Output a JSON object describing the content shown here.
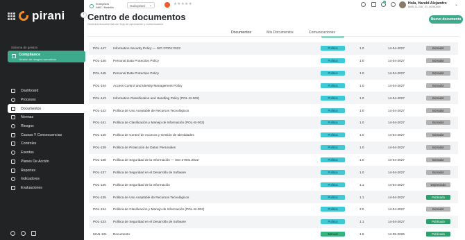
{
  "brand": {
    "logo_text": "pirani",
    "accent": "#3eaa8d",
    "logo_color": "#f28c28"
  },
  "sidebar": {
    "system_label": "Sistema de gestión",
    "system_title": "Compliance",
    "system_subtitle": "Gestión de riesgos normativos",
    "items": [
      {
        "label": "Dashboard",
        "icon": "monitor-icon"
      },
      {
        "label": "Procesos",
        "icon": "process-icon"
      },
      {
        "label": "Documentos",
        "icon": "document-icon",
        "active": true
      },
      {
        "label": "Normas",
        "icon": "list-icon"
      },
      {
        "label": "Riesgos",
        "icon": "risk-icon"
      },
      {
        "label": "Causas Y Consecuencias",
        "icon": "cause-icon"
      },
      {
        "label": "Controles",
        "icon": "controls-icon"
      },
      {
        "label": "Eventos",
        "icon": "event-icon"
      },
      {
        "label": "Planes De Acción",
        "icon": "flag-icon"
      },
      {
        "label": "Reportes",
        "icon": "chart-icon"
      },
      {
        "label": "Indicadores",
        "icon": "gauge-icon"
      },
      {
        "label": "Evaluaciones",
        "icon": "checklist-icon"
      }
    ],
    "footer_icons": [
      "help-icon",
      "users-icon",
      "card-icon"
    ]
  },
  "topbar": {
    "entity_line1": "Enterprises",
    "entity_line2": "NMC / Medellín",
    "guide_label": "Guía pirani",
    "rating": "★★★★★",
    "notification_count": "1",
    "user_name": "Hola, Harold Alejandro",
    "user_sub": "MAN 11.238 · ID: 00000000"
  },
  "header": {
    "title": "Centro de documentos",
    "subtitle": "Gestiona documental con flujo de aprobación y comunicación",
    "new_button": "Nuevo documento"
  },
  "tabs": [
    "Documentos",
    "Mis Documentos",
    "Comunicaciones"
  ],
  "table": {
    "rows": [
      {
        "code": "POL-147",
        "title": "Information Security Policy — ISO 27001:2022",
        "type": "Política",
        "version": "1.0",
        "date": "14-04-2027",
        "status": "Borrador"
      },
      {
        "code": "POL-146",
        "title": "Personal Data Protection Policy",
        "type": "Política",
        "version": "1.0",
        "date": "14-04-2027",
        "status": "Borrador"
      },
      {
        "code": "POL-145",
        "title": "Personal Data Protection Policy",
        "type": "Política",
        "version": "1.0",
        "date": "14-04-2027",
        "status": "Borrador"
      },
      {
        "code": "POL-144",
        "title": "Access Control and Identity Management Policy",
        "type": "Política",
        "version": "1.0",
        "date": "14-04-2027",
        "status": "Borrador"
      },
      {
        "code": "POL-143",
        "title": "Information Classification and Handling Policy (POL-SI-002)",
        "type": "Política",
        "version": "1.0",
        "date": "14-04-2027",
        "status": "Borrador"
      },
      {
        "code": "POL-142",
        "title": "Política de Uso Aceptable de Recursos Tecnológicos",
        "type": "Política",
        "version": "1.0",
        "date": "14-04-2027",
        "status": "Borrador"
      },
      {
        "code": "POL-141",
        "title": "Política de Clasificación y Manejo de Información (POL-SI-002)",
        "type": "Política",
        "version": "1.0",
        "date": "14-04-2027",
        "status": "Borrador"
      },
      {
        "code": "POL-140",
        "title": "Política de Control de Accesos y Gestión de Identidades",
        "type": "Política",
        "version": "1.0",
        "date": "14-04-2027",
        "status": "Borrador"
      },
      {
        "code": "POL-139",
        "title": "Política de Protección de Datos Personales",
        "type": "Política",
        "version": "1.0",
        "date": "14-04-2027",
        "status": "Borrador"
      },
      {
        "code": "POL-138",
        "title": "Política de Seguridad de la Información — ISO 27001:2022",
        "type": "Política",
        "version": "1.0",
        "date": "14-04-2027",
        "status": "Borrador"
      },
      {
        "code": "POL-137",
        "title": "Política de Seguridad en el Desarrollo de Software",
        "type": "Política",
        "version": "1.0",
        "date": "14-04-2027",
        "status": "Borrador"
      },
      {
        "code": "POL-136",
        "title": "Política de Seguridad de la Información",
        "type": "Política",
        "version": "1.1",
        "date": "14-04-2027",
        "status": "Depreciado"
      },
      {
        "code": "POL-135",
        "title": "Política de Uso Aceptable de Recursos Tecnológicos",
        "type": "Política",
        "version": "1.1",
        "date": "14-04-2027",
        "status": "Publicado"
      },
      {
        "code": "POL-134",
        "title": "Política de Clasificación y Manejo de Información (POL-SI-002)",
        "type": "Política",
        "version": "2.0",
        "date": "14-04-2027",
        "status": "Borrador"
      },
      {
        "code": "POL-133",
        "title": "Política de Seguridad en el Desarrollo de Software",
        "type": "Política",
        "version": "1.1",
        "date": "14-04-2027",
        "status": "Publicado"
      },
      {
        "code": "MAN-121",
        "title": "Documento",
        "type": "Manual",
        "version": "1.6",
        "date": "14-05-2026",
        "status": "Publicado"
      }
    ]
  }
}
